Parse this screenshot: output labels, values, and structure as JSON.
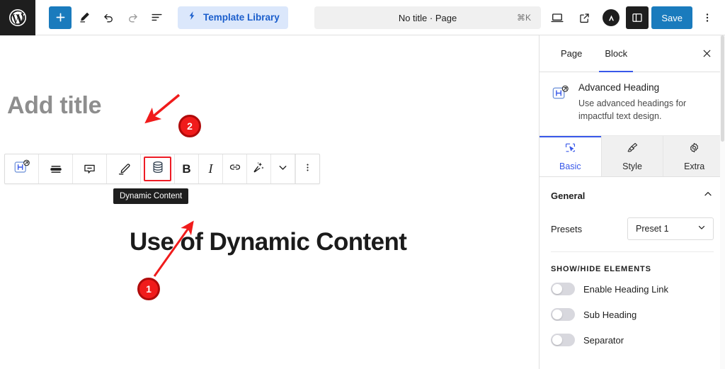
{
  "topbar": {
    "wp_logo_icon": "wordpress-logo-icon",
    "add_block_label": "+",
    "add_block_icon": "plus-icon",
    "tools_icon": "pencil-tools-icon",
    "undo_icon": "undo-arrow-icon",
    "redo_icon": "redo-arrow-icon",
    "list_view_icon": "document-outline-icon",
    "template_library": {
      "label": "Template Library",
      "icon": "template-library-icon",
      "bg_color": "#dbe7fb",
      "text_color": "#1b5ecc"
    },
    "document_bar": {
      "title": "No title · Page",
      "shortcut": "⌘K"
    },
    "view_icon": "desktop-preview-icon",
    "external_icon": "external-link-icon",
    "brand_avatar_icon": "brand-avatar-icon",
    "sidebar_toggle_icon": "sidebar-panel-icon",
    "save_label": "Save",
    "save_bg_color": "#1a7bbd",
    "options_icon": "kebab-menu-icon"
  },
  "canvas": {
    "title_placeholder": "Add title",
    "heading_text": "Use of Dynamic Content"
  },
  "block_toolbar": {
    "items": [
      {
        "name": "block-type-advanced-heading",
        "icon": "advanced-heading-block-icon",
        "label": ""
      },
      {
        "name": "align-options",
        "icon": "paragraph-align-icon",
        "label": ""
      },
      {
        "name": "comment",
        "icon": "comment-icon",
        "label": ""
      },
      {
        "name": "highlight",
        "icon": "highlighter-pen-icon",
        "label": ""
      },
      {
        "name": "dynamic-content",
        "icon": "database-cylinder-icon",
        "label": ""
      },
      {
        "name": "bold",
        "icon": "bold-icon",
        "label": "B"
      },
      {
        "name": "italic",
        "icon": "italic-icon",
        "label": "I"
      },
      {
        "name": "link",
        "icon": "link-icon",
        "label": ""
      },
      {
        "name": "ai-assistant",
        "icon": "ai-sparkle-wand-icon",
        "label": ""
      },
      {
        "name": "more-formatting",
        "icon": "chevron-down-icon",
        "label": ""
      },
      {
        "name": "block-options",
        "icon": "kebab-menu-icon",
        "label": ""
      }
    ],
    "highlight_color": "#ee1c25",
    "tooltip": "Dynamic Content"
  },
  "annotations": [
    {
      "number": "1",
      "target": "heading-text",
      "color": "#f01b1b"
    },
    {
      "number": "2",
      "target": "dynamic-content-button",
      "color": "#f01b1b"
    }
  ],
  "sidebar": {
    "tabs": [
      {
        "label": "Page",
        "active": false
      },
      {
        "label": "Block",
        "active": true
      }
    ],
    "close_icon": "close-icon",
    "block_card": {
      "icon": "advanced-heading-block-icon",
      "title": "Advanced Heading",
      "description": "Use advanced headings for impactful text design."
    },
    "subtabs": [
      {
        "label": "Basic",
        "icon": "cursor-select-icon",
        "active": true
      },
      {
        "label": "Style",
        "icon": "paintbrush-icon",
        "active": false
      },
      {
        "label": "Extra",
        "icon": "gear-icon",
        "active": false
      }
    ],
    "accent_color": "#3858e9",
    "general": {
      "title": "General",
      "collapse_icon": "chevron-up-icon",
      "presets": {
        "label": "Presets",
        "value": "Preset 1",
        "chevron_icon": "chevron-down-icon"
      },
      "show_hide_label": "SHOW/HIDE ELEMENTS",
      "toggles": [
        {
          "label": "Enable Heading Link",
          "on": false
        },
        {
          "label": "Sub Heading",
          "on": false
        },
        {
          "label": "Separator",
          "on": false
        }
      ]
    }
  }
}
